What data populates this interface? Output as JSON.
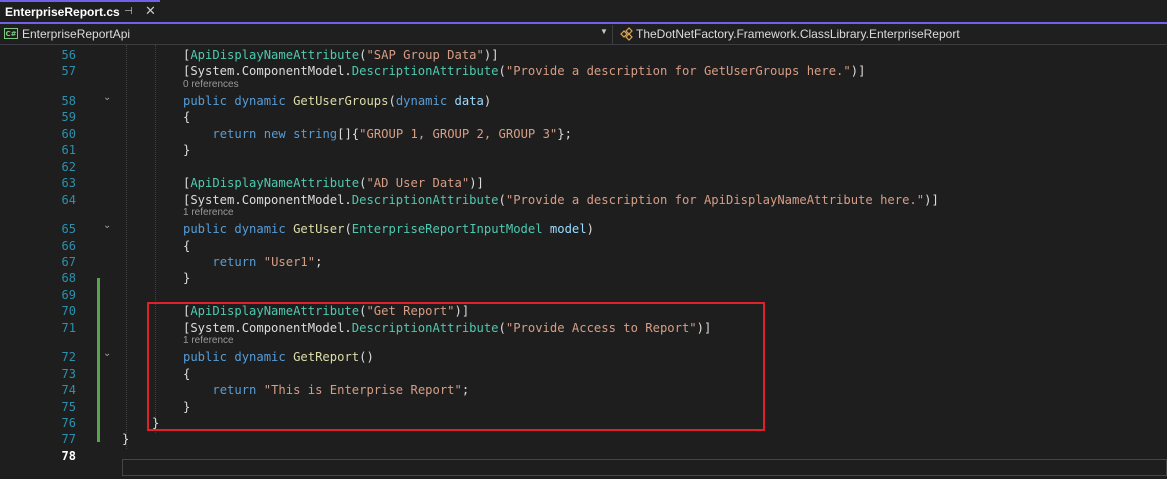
{
  "tab": {
    "title": "EnterpriseReport.cs",
    "pin_icon": "pin-icon",
    "close_icon": "close-icon"
  },
  "navbar": {
    "project_icon": "csharp-project-icon",
    "project": "EnterpriseReportApi",
    "class_icon": "class-icon",
    "class_path": "TheDotNetFactory.Framework.ClassLibrary.EnterpriseReport"
  },
  "colors": {
    "keyword": "#569cd6",
    "type": "#4ec9b0",
    "method": "#dcdcaa",
    "string": "#d69d85",
    "parameter": "#9cdcfe",
    "line_number": "#2b91af",
    "highlight": "#e0202a",
    "change_bar": "#57a64a"
  },
  "editor": {
    "lines": [
      {
        "num": "56",
        "tokens": [
          [
            "p",
            "["
          ],
          [
            "t",
            "ApiDisplayNameAttribute"
          ],
          [
            "p",
            "("
          ],
          [
            "s",
            "\"SAP Group Data\""
          ],
          [
            "p",
            ")]"
          ]
        ]
      },
      {
        "num": "57",
        "tokens": [
          [
            "p",
            "[System.ComponentModel."
          ],
          [
            "t",
            "DescriptionAttribute"
          ],
          [
            "p",
            "("
          ],
          [
            "s",
            "\"Provide a description for GetUserGroups here.\""
          ],
          [
            "p",
            ")]"
          ]
        ]
      },
      {
        "num": "58",
        "codelens": "0 references",
        "fold": true,
        "tokens": [
          [
            "k",
            "public "
          ],
          [
            "k",
            "dynamic "
          ],
          [
            "f",
            "GetUserGroups"
          ],
          [
            "p",
            "("
          ],
          [
            "k",
            "dynamic "
          ],
          [
            "v",
            "data"
          ],
          [
            "p",
            ")"
          ]
        ]
      },
      {
        "num": "59",
        "tokens": [
          [
            "p",
            "{"
          ]
        ]
      },
      {
        "num": "60",
        "tokens": [
          [
            "p",
            "    "
          ],
          [
            "k",
            "return "
          ],
          [
            "k",
            "new "
          ],
          [
            "k",
            "string"
          ],
          [
            "p",
            "[]{"
          ],
          [
            "s",
            "\"GROUP 1, GROUP 2, GROUP 3\""
          ],
          [
            "p",
            "};"
          ]
        ]
      },
      {
        "num": "61",
        "tokens": [
          [
            "p",
            "}"
          ]
        ]
      },
      {
        "num": "62",
        "tokens": []
      },
      {
        "num": "63",
        "tokens": [
          [
            "p",
            "["
          ],
          [
            "t",
            "ApiDisplayNameAttribute"
          ],
          [
            "p",
            "("
          ],
          [
            "s",
            "\"AD User Data\""
          ],
          [
            "p",
            ")]"
          ]
        ]
      },
      {
        "num": "64",
        "tokens": [
          [
            "p",
            "[System.ComponentModel."
          ],
          [
            "t",
            "DescriptionAttribute"
          ],
          [
            "p",
            "("
          ],
          [
            "s",
            "\"Provide a description for ApiDisplayNameAttribute here.\""
          ],
          [
            "p",
            ")]"
          ]
        ]
      },
      {
        "num": "65",
        "codelens": "1 reference",
        "fold": true,
        "tokens": [
          [
            "k",
            "public "
          ],
          [
            "k",
            "dynamic "
          ],
          [
            "f",
            "GetUser"
          ],
          [
            "p",
            "("
          ],
          [
            "t",
            "EnterpriseReportInputModel "
          ],
          [
            "v",
            "model"
          ],
          [
            "p",
            ")"
          ]
        ]
      },
      {
        "num": "66",
        "tokens": [
          [
            "p",
            "{"
          ]
        ]
      },
      {
        "num": "67",
        "tokens": [
          [
            "p",
            "    "
          ],
          [
            "k",
            "return "
          ],
          [
            "s",
            "\"User1\""
          ],
          [
            "p",
            ";"
          ]
        ]
      },
      {
        "num": "68",
        "tokens": [
          [
            "p",
            "}"
          ]
        ]
      },
      {
        "num": "69",
        "tokens": []
      },
      {
        "num": "70",
        "tokens": [
          [
            "p",
            "["
          ],
          [
            "t",
            "ApiDisplayNameAttribute"
          ],
          [
            "p",
            "("
          ],
          [
            "s",
            "\"Get Report\""
          ],
          [
            "p",
            ")]"
          ]
        ]
      },
      {
        "num": "71",
        "tokens": [
          [
            "p",
            "[System.ComponentModel."
          ],
          [
            "t",
            "DescriptionAttribute"
          ],
          [
            "p",
            "("
          ],
          [
            "s",
            "\"Provide Access to Report\""
          ],
          [
            "p",
            ")]"
          ]
        ]
      },
      {
        "num": "72",
        "codelens": "1 reference",
        "fold": true,
        "tokens": [
          [
            "k",
            "public "
          ],
          [
            "k",
            "dynamic "
          ],
          [
            "f",
            "GetReport"
          ],
          [
            "p",
            "()"
          ]
        ]
      },
      {
        "num": "73",
        "tokens": [
          [
            "p",
            "{"
          ]
        ]
      },
      {
        "num": "74",
        "tokens": [
          [
            "p",
            "    "
          ],
          [
            "k",
            "return "
          ],
          [
            "s",
            "\"This is Enterprise Report\""
          ],
          [
            "p",
            ";"
          ]
        ]
      },
      {
        "num": "75",
        "tokens": [
          [
            "p",
            "}"
          ]
        ]
      },
      {
        "num": "76",
        "tokens": [
          [
            "p",
            "}"
          ]
        ]
      },
      {
        "num": "77",
        "tokens": [
          [
            "p",
            "}"
          ]
        ]
      },
      {
        "num": "78",
        "current": true,
        "tokens": []
      }
    ]
  }
}
